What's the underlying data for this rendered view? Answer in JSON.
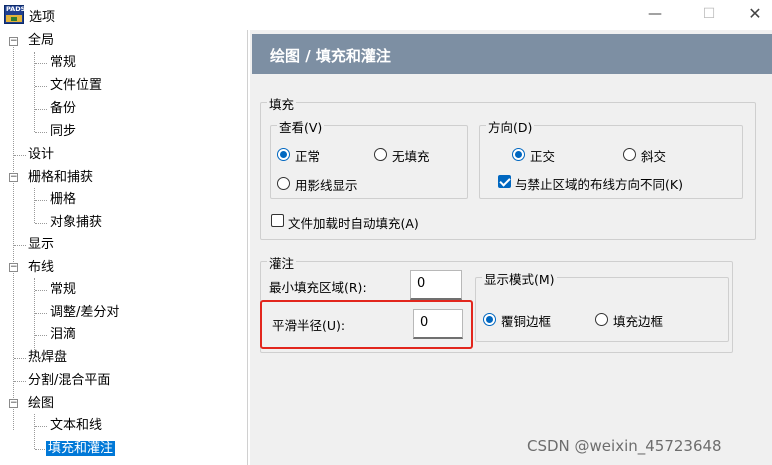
{
  "window": {
    "icon_text": "PADS",
    "title": "选项",
    "minimize_glyph": "—",
    "maximize_glyph": "☐",
    "close_glyph": "✕"
  },
  "tree": {
    "items": [
      {
        "label": "全局",
        "expanded": true
      },
      {
        "label": "常规"
      },
      {
        "label": "文件位置"
      },
      {
        "label": "备份"
      },
      {
        "label": "同步"
      },
      {
        "label": "设计"
      },
      {
        "label": "栅格和捕获",
        "expanded": true
      },
      {
        "label": "栅格"
      },
      {
        "label": "对象捕获"
      },
      {
        "label": "显示"
      },
      {
        "label": "布线",
        "expanded": true
      },
      {
        "label": "常规"
      },
      {
        "label": "调整/差分对"
      },
      {
        "label": "泪滴"
      },
      {
        "label": "热焊盘"
      },
      {
        "label": "分割/混合平面"
      },
      {
        "label": "绘图",
        "expanded": true
      },
      {
        "label": "文本和线"
      },
      {
        "label": "填充和灌注",
        "selected": true
      }
    ],
    "expander_glyph": "−"
  },
  "panel": {
    "header": "绘图 / 填充和灌注",
    "header_color": "#7d8fa3",
    "fill": {
      "title": "填充",
      "view": {
        "title": "查看(V)",
        "options": [
          "正常",
          "无填充",
          "用影线显示"
        ],
        "selected": "正常"
      },
      "direction": {
        "title": "方向(D)",
        "options": [
          "正交",
          "斜交"
        ],
        "selected": "正交",
        "checkbox_label": "与禁止区域的布线方向不同(K)",
        "checkbox_checked": true
      },
      "autofill_label": "文件加载时自动填充(A)",
      "autofill_checked": false
    },
    "pour": {
      "title": "灌注",
      "min_fill_label": "最小填充区域(R):",
      "min_fill_value": "0",
      "smooth_radius_label": "平滑半径(U):",
      "smooth_radius_value": "0",
      "display_mode": {
        "title": "显示模式(M)",
        "options": [
          "覆铜边框",
          "填充边框"
        ],
        "selected": "覆铜边框"
      }
    },
    "highlight_color": "#e2261d"
  },
  "watermark": "CSDN @weixin_45723648"
}
